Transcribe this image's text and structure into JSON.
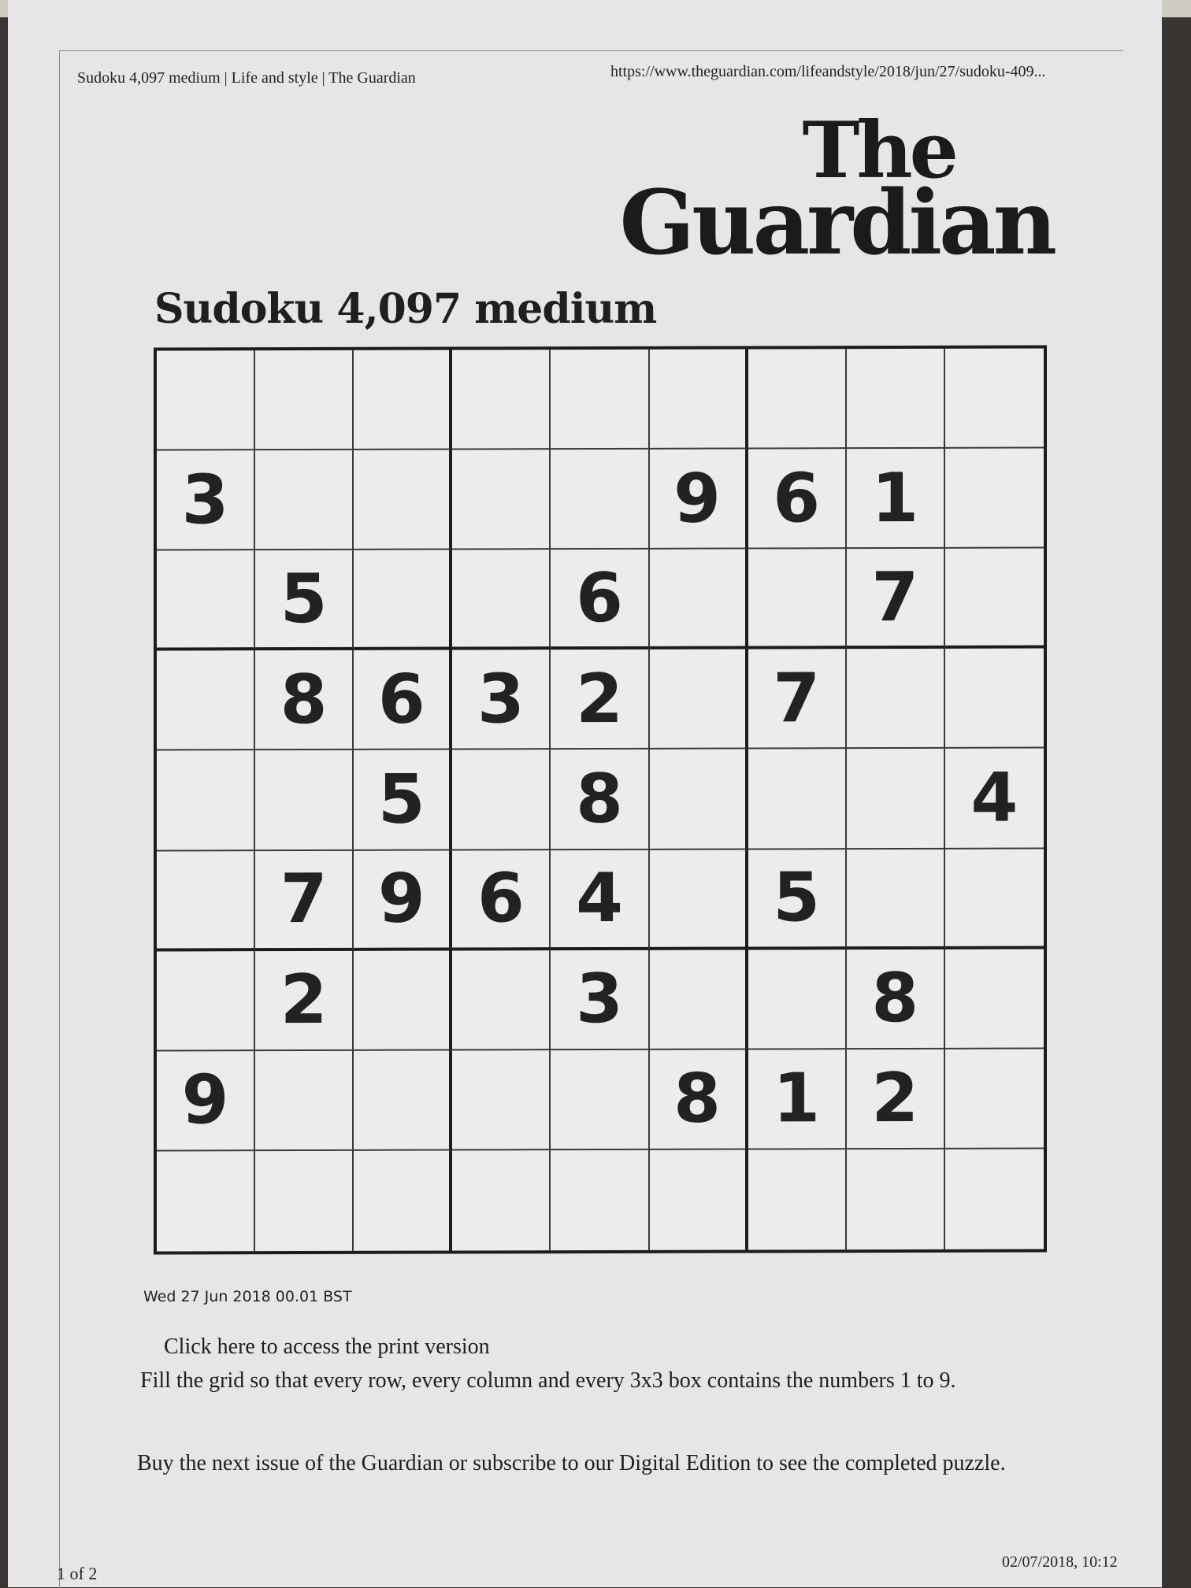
{
  "header": {
    "title": "Sudoku 4,097 medium | Life and style | The Guardian",
    "url": "https://www.theguardian.com/lifeandstyle/2018/jun/27/sudoku-409..."
  },
  "logo": {
    "line1": "The",
    "line2": "Guardian"
  },
  "puzzle": {
    "title": "Sudoku 4,097 medium",
    "grid": [
      [
        "",
        "",
        "",
        "",
        "",
        "",
        "",
        "",
        ""
      ],
      [
        "3",
        "",
        "",
        "",
        "",
        "9",
        "6",
        "1",
        ""
      ],
      [
        "",
        "5",
        "",
        "",
        "6",
        "",
        "",
        "7",
        ""
      ],
      [
        "",
        "8",
        "6",
        "3",
        "2",
        "",
        "7",
        "",
        ""
      ],
      [
        "",
        "",
        "5",
        "",
        "8",
        "",
        "",
        "",
        "4"
      ],
      [
        "",
        "7",
        "9",
        "6",
        "4",
        "",
        "5",
        "",
        ""
      ],
      [
        "",
        "2",
        "",
        "",
        "3",
        "",
        "",
        "8",
        ""
      ],
      [
        "9",
        "",
        "",
        "",
        "",
        "8",
        "1",
        "2",
        ""
      ],
      [
        "",
        "",
        "",
        "",
        "",
        "",
        "",
        "",
        ""
      ]
    ]
  },
  "article": {
    "date": "Wed 27 Jun 2018 00.01 BST",
    "print_link": "Click here to access the print version",
    "instructions": "Fill the grid so that every row, every column and every 3x3 box contains the numbers 1 to 9.",
    "buy_text": "Buy the next issue of the Guardian or subscribe to our Digital Edition to see the completed puzzle."
  },
  "footer": {
    "page": "1 of 2",
    "timestamp": "02/07/2018, 10:12"
  }
}
